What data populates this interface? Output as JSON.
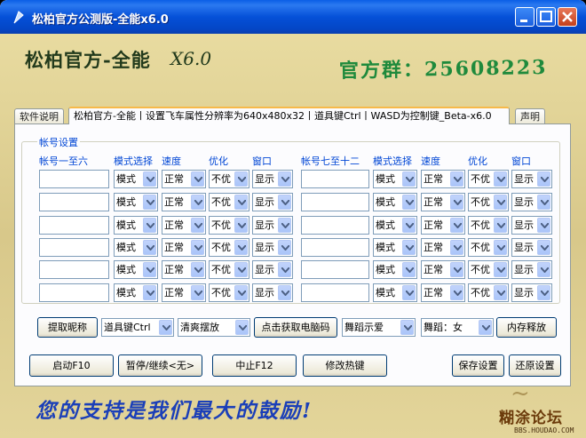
{
  "window": {
    "title": "松柏官方公测版-全能x6.0"
  },
  "banner": {
    "title": "松柏官方-全能",
    "version": "X6.0",
    "group": "官方群：25608223"
  },
  "tabs": [
    {
      "label": "软件说明"
    },
    {
      "label": "松柏官方-全能丨设置飞车属性分辨率为640x480x32丨道具键Ctrl丨WASD为控制键_Beta-x6.0"
    },
    {
      "label": "声明"
    }
  ],
  "accounts": {
    "group_title": "帐号设置",
    "headers": [
      "帐号一至六",
      "模式选择",
      "速度",
      "优化",
      "窗口",
      "帐号七至十二",
      "模式选择",
      "速度",
      "优化",
      "窗口"
    ],
    "mode_value": "模式",
    "speed_value": "正常",
    "opt_value": "不优",
    "window_value": "显示"
  },
  "actions": {
    "fetch_nick": "提取昵称",
    "item_key": "道具键Ctrl",
    "clean": "清爽摆放",
    "get_pc": "点击获取电脑码",
    "dance1": "舞蹈示爱",
    "dance2": "舞蹈：女",
    "mem_release": "内存释放"
  },
  "controls": {
    "start": "启动F10",
    "pause": "暂停/继续<无>",
    "stop": "中止F12",
    "hotkeys": "修改热键",
    "save": "保存设置",
    "restore": "还原设置"
  },
  "footer": {
    "slogan": "您的支持是我们最大的鼓励!",
    "watermark": "糊涂论坛",
    "watermark_url": "BBS.HOUDAO.COM"
  },
  "colors": {
    "title_bar": "#0550d8",
    "group_label": "#0046d5",
    "slogan": "#1b3fb8",
    "group_number": "#1f8a3c"
  }
}
